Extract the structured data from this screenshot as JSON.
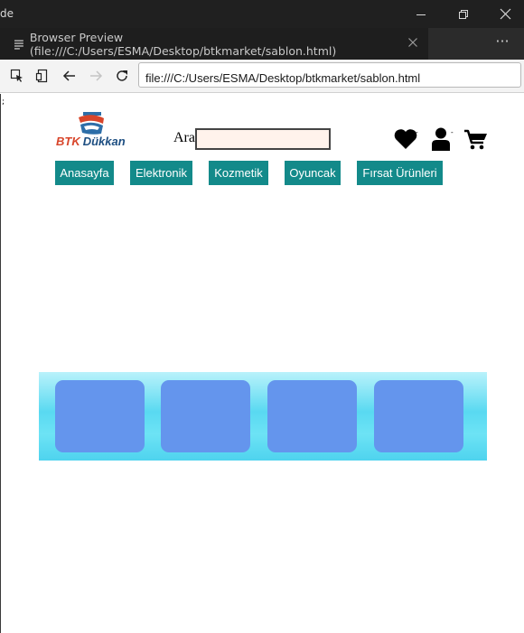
{
  "window": {
    "title_fragment": "de"
  },
  "tab": {
    "title": "Browser Preview (file:///C:/Users/ESMA/Desktop/btkmarket/sablon.html)"
  },
  "navbar": {
    "url": "file:///C:/Users/ESMA/Desktop/btkmarket/sablon.html"
  },
  "page": {
    "stray_mark": ";",
    "logo": {
      "text_btk": "BTK",
      "text_dukkan": "Dükkan"
    },
    "search": {
      "label": "Ara",
      "value": ""
    },
    "header_icons": {
      "favorites_count": "-",
      "account_count": "-"
    },
    "menu": [
      {
        "label": "Anasayfa"
      },
      {
        "label": "Elektronik"
      },
      {
        "label": "Kozmetik"
      },
      {
        "label": "Oyuncak"
      },
      {
        "label": "Fırsat Ürünleri"
      }
    ],
    "colors": {
      "menu_bg": "#138a8a",
      "card_bg": "#6495ed",
      "banner_mid": "#59d9f1",
      "search_bg": "#fff3ec"
    }
  }
}
